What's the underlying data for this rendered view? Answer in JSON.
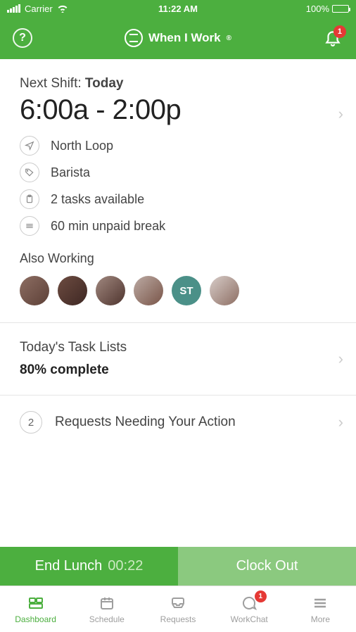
{
  "status": {
    "carrier": "Carrier",
    "time": "11:22 AM",
    "battery": "100%"
  },
  "header": {
    "app_name": "When I Work",
    "notification_count": "1"
  },
  "shift": {
    "label_prefix": "Next Shift: ",
    "label_day": "Today",
    "time": "6:00a - 2:00p",
    "location": "North Loop",
    "position": "Barista",
    "tasks": "2 tasks available",
    "break": "60 min unpaid break",
    "also_working_label": "Also Working",
    "avatars": [
      "",
      "",
      "",
      "",
      "ST",
      ""
    ]
  },
  "tasklist": {
    "title": "Today's Task Lists",
    "completion": "80% complete"
  },
  "requests": {
    "count": "2",
    "label": "Requests Needing Your Action"
  },
  "actions": {
    "end_lunch": "End Lunch",
    "timer": "00:22",
    "clock_out": "Clock Out"
  },
  "tabs": {
    "dashboard": "Dashboard",
    "schedule": "Schedule",
    "requests": "Requests",
    "workchat": "WorkChat",
    "workchat_badge": "1",
    "more": "More"
  }
}
